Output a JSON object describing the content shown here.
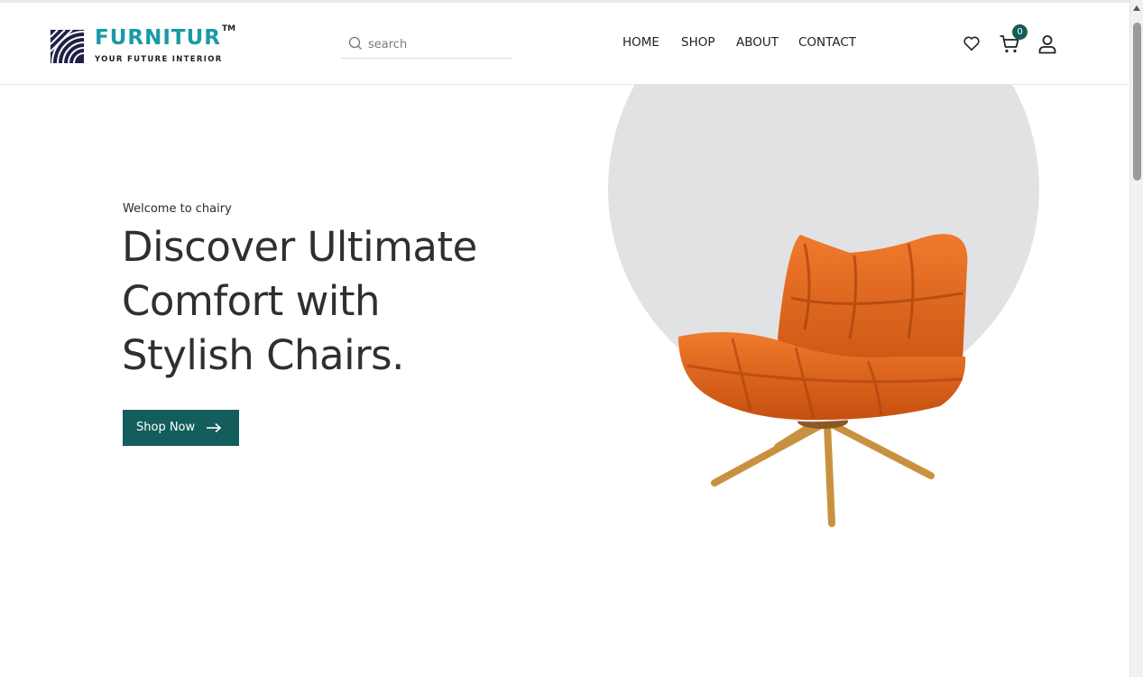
{
  "brand": {
    "name": "FURNITUR",
    "trademark": "TM",
    "tagline": "YOUR FUTURE INTERIOR",
    "color": "#1a9aa6"
  },
  "search": {
    "placeholder": "search",
    "value": "",
    "icon": "search-icon"
  },
  "nav": {
    "items": [
      {
        "label": "HOME"
      },
      {
        "label": "SHOP"
      },
      {
        "label": "ABOUT"
      },
      {
        "label": "CONTACT"
      }
    ]
  },
  "header_icons": {
    "wishlist": "heart-icon",
    "cart": "cart-icon",
    "cart_count": "0",
    "account": "user-icon"
  },
  "hero": {
    "welcome": "Welcome to chairy",
    "headline_lines": [
      "Discover Ultimate",
      "Comfort with",
      "Stylish Chairs."
    ],
    "cta_label": "Shop Now",
    "cta_icon": "arrow-right-icon",
    "image": "orange-lounge-chair"
  },
  "colors": {
    "accent": "#135e5c",
    "circle": "#e1e2e4",
    "chair_orange": "#e0641c",
    "chair_legs": "#c9913f"
  }
}
